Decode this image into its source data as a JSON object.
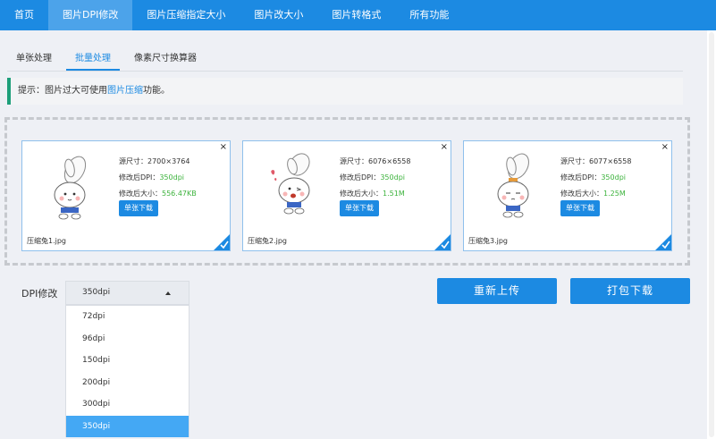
{
  "nav": {
    "items": [
      {
        "label": "首页"
      },
      {
        "label": "图片DPI修改"
      },
      {
        "label": "图片压缩指定大小"
      },
      {
        "label": "图片改大小"
      },
      {
        "label": "图片转格式"
      },
      {
        "label": "所有功能"
      }
    ],
    "active_index": 1
  },
  "tabs": {
    "items": [
      {
        "label": "单张处理"
      },
      {
        "label": "批量处理"
      },
      {
        "label": "像素尺寸换算器"
      }
    ],
    "active_index": 1
  },
  "tip": {
    "prefix": "提示：图片过大可使用",
    "link": "图片压缩",
    "suffix": "功能。"
  },
  "cards": [
    {
      "source_label": "源尺寸：",
      "source_value": "2700×3764",
      "dpi_label": "修改后DPI：",
      "dpi_value": "350dpi",
      "size_label": "修改后大小：",
      "size_value": "556.47KB",
      "download_label": "单张下载",
      "filename": "压缩兔1.jpg",
      "close": "×"
    },
    {
      "source_label": "源尺寸：",
      "source_value": "6076×6558",
      "dpi_label": "修改后DPI：",
      "dpi_value": "350dpi",
      "size_label": "修改后大小：",
      "size_value": "1.51M",
      "download_label": "单张下载",
      "filename": "压缩兔2.jpg",
      "close": "×"
    },
    {
      "source_label": "源尺寸：",
      "source_value": "6077×6558",
      "dpi_label": "修改后DPI：",
      "dpi_value": "350dpi",
      "size_label": "修改后大小：",
      "size_value": "1.25M",
      "download_label": "单张下载",
      "filename": "压缩兔3.jpg",
      "close": "×"
    }
  ],
  "dpi": {
    "label": "DPI修改",
    "selected": "350dpi",
    "options": [
      "72dpi",
      "96dpi",
      "150dpi",
      "200dpi",
      "300dpi",
      "350dpi"
    ],
    "selected_index": 5
  },
  "buttons": {
    "reupload": "重新上传",
    "download_zip": "打包下载"
  },
  "colors": {
    "primary": "#1c8ae2",
    "green": "#3db33d",
    "tip_border": "#1d9f7a",
    "selected_option": "#44a8f4"
  }
}
